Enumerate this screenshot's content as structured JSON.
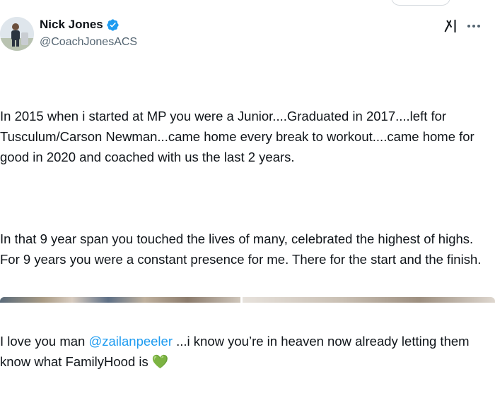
{
  "author": {
    "name": "Nick Jones",
    "handle": "@CoachJonesACS"
  },
  "icons": {
    "verified": "verified-badge-icon",
    "grok": "grok-icon",
    "more": "more-icon",
    "heart": "green-heart-icon"
  },
  "colors": {
    "mention": "#1d9bf0",
    "verified": "#1d9bf0",
    "secondary_text": "#536471",
    "heart": "#5ab94d"
  },
  "tweet": {
    "p1": "In 2015 when i started at MP you were a Junior....Graduated in 2017....left for Tusculum/Carson Newman...came home every break to workout....came home for good in 2020 and coached with us the last 2 years.",
    "p2": "In that 9 year span you touched the lives of many, celebrated the highest of highs. For 9 years you were a constant presence for me. There for the start and the finish.",
    "p3_before": "I love you man ",
    "p3_mention": "@zailanpeeler",
    "p3_after": " ...i know you’re in heaven now already letting them know what FamilyHood is ",
    "p3_emoji": "💚"
  }
}
